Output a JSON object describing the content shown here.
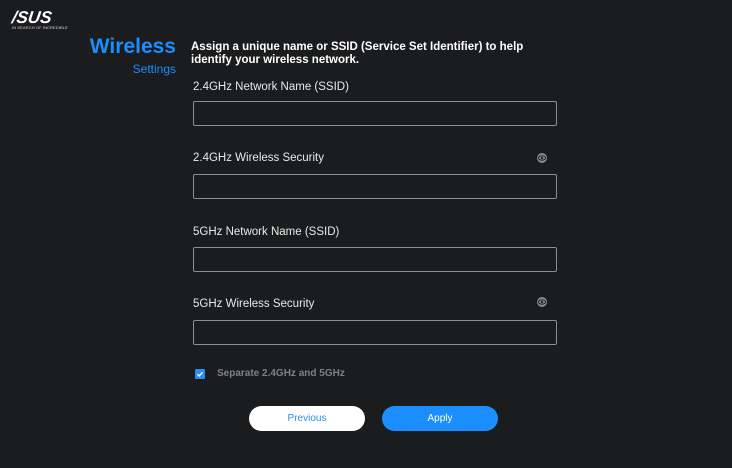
{
  "brand": {
    "logo_text": "/SUS",
    "tagline": "IN SEARCH OF INCREDIBLE"
  },
  "side": {
    "title": "Wireless",
    "subtitle": "Settings"
  },
  "intro": {
    "text": "Assign a unique name or SSID (Service Set Identifier) to help identify your wireless network."
  },
  "fields": [
    {
      "label": "2.4GHz Network Name (SSID)",
      "value": "",
      "placeholder": ""
    },
    {
      "label": "2.4GHz Wireless Security",
      "value": "",
      "placeholder": ""
    },
    {
      "label": "5GHz Network Name (SSID)",
      "value": "",
      "placeholder": ""
    },
    {
      "label": "5GHz Wireless Security",
      "value": "",
      "placeholder": ""
    }
  ],
  "icons": {
    "eye_1": "eye-icon",
    "eye_2": "eye-icon",
    "check": "check-icon"
  },
  "separate": {
    "label": "Separate 2.4GHz and 5GHz",
    "checked": true
  },
  "buttons": {
    "previous": "Previous",
    "apply": "Apply"
  },
  "colors": {
    "background": "#1b1c1e",
    "accent": "#1a8dff",
    "input_border": "#8d8e90",
    "muted_text": "#7f8083"
  }
}
